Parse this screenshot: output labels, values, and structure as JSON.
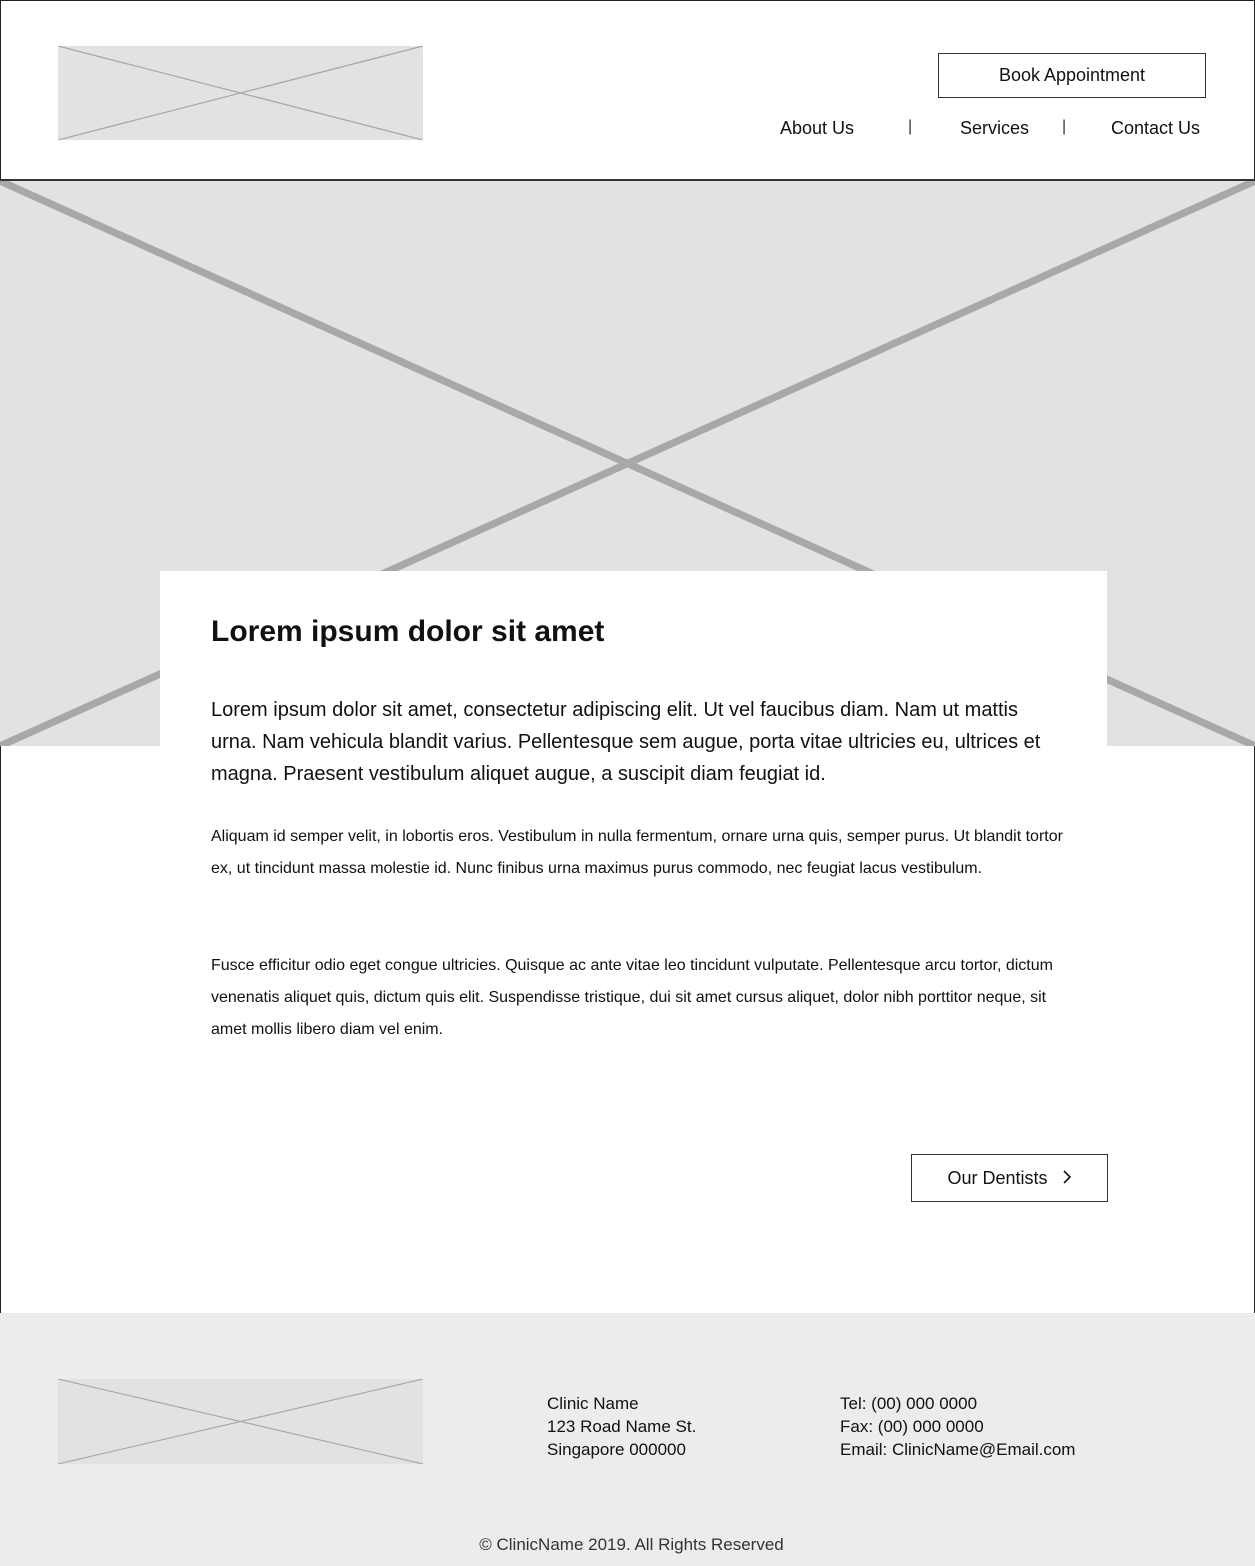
{
  "header": {
    "book_label": "Book Appointment",
    "nav": [
      {
        "label": "About Us"
      },
      {
        "label": "Services"
      },
      {
        "label": "Contact Us"
      }
    ],
    "separator": "|"
  },
  "content": {
    "title": "Lorem ipsum dolor sit amet",
    "lead": "Lorem ipsum dolor sit amet, consectetur adipiscing elit. Ut vel faucibus diam. Nam ut mattis urna. Nam vehicula blandit varius. Pellentesque sem augue, porta vitae ultricies eu, ultrices et magna. Praesent vestibulum aliquet augue, a suscipit diam feugiat id.",
    "paragraph1": "Aliquam id semper velit, in lobortis eros. Vestibulum in nulla fermentum, ornare urna quis, semper purus. Ut blandit tortor ex, ut tincidunt massa molestie id. Nunc finibus urna maximus purus commodo, nec feugiat lacus vestibulum.",
    "paragraph2": "Fusce efficitur odio eget congue ultricies. Quisque ac ante vitae leo tincidunt vulputate. Pellentesque arcu tortor, dictum venenatis aliquet quis, dictum quis elit. Suspendisse tristique, dui sit amet cursus aliquet, dolor nibh porttitor neque, sit amet mollis libero diam vel enim.",
    "dentists_label": "Our Dentists",
    "dentists_icon": "chevron-right-icon"
  },
  "footer": {
    "address": [
      "Clinic Name",
      "123 Road Name St.",
      "Singapore 000000"
    ],
    "contact": [
      "Tel: (00) 000 0000",
      "Fax: (00) 000 0000",
      "Email: ClinicName@Email.com"
    ],
    "copyright": "© ClinicName 2019. All Rights Reserved"
  },
  "colors": {
    "placeholder": "#e2e2e2",
    "footer_bg": "#ececec",
    "border": "#333333"
  }
}
